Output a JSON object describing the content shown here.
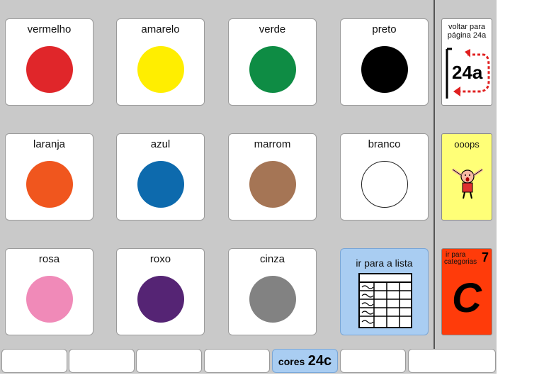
{
  "colors": [
    {
      "label": "vermelho",
      "color": "#e0262a"
    },
    {
      "label": "amarelo",
      "color": "#ffee00"
    },
    {
      "label": "verde",
      "color": "#0e8c44"
    },
    {
      "label": "preto",
      "color": "#000000"
    },
    {
      "label": "laranja",
      "color": "#f0561e"
    },
    {
      "label": "azul",
      "color": "#0d6aad"
    },
    {
      "label": "marrom",
      "color": "#a57555"
    },
    {
      "label": "branco",
      "color": "#ffffff"
    },
    {
      "label": "rosa",
      "color": "#f08ab8"
    },
    {
      "label": "roxo",
      "color": "#552474"
    },
    {
      "label": "cinza",
      "color": "#828282"
    }
  ],
  "go_to_list": {
    "label": "ir para a lista",
    "bg": "#a9cdf2"
  },
  "side": {
    "back": {
      "line1": "voltar para",
      "line2": "página 24a",
      "page": "24a"
    },
    "ooops": {
      "label": "ooops",
      "bg": "#ffff77"
    },
    "categories": {
      "line1": "ir para",
      "line2": "categorias",
      "number": "7",
      "letter": "C",
      "bg": "#ff3b0a"
    }
  },
  "tabs": {
    "active_prefix": "cores",
    "active_page": "24c"
  }
}
